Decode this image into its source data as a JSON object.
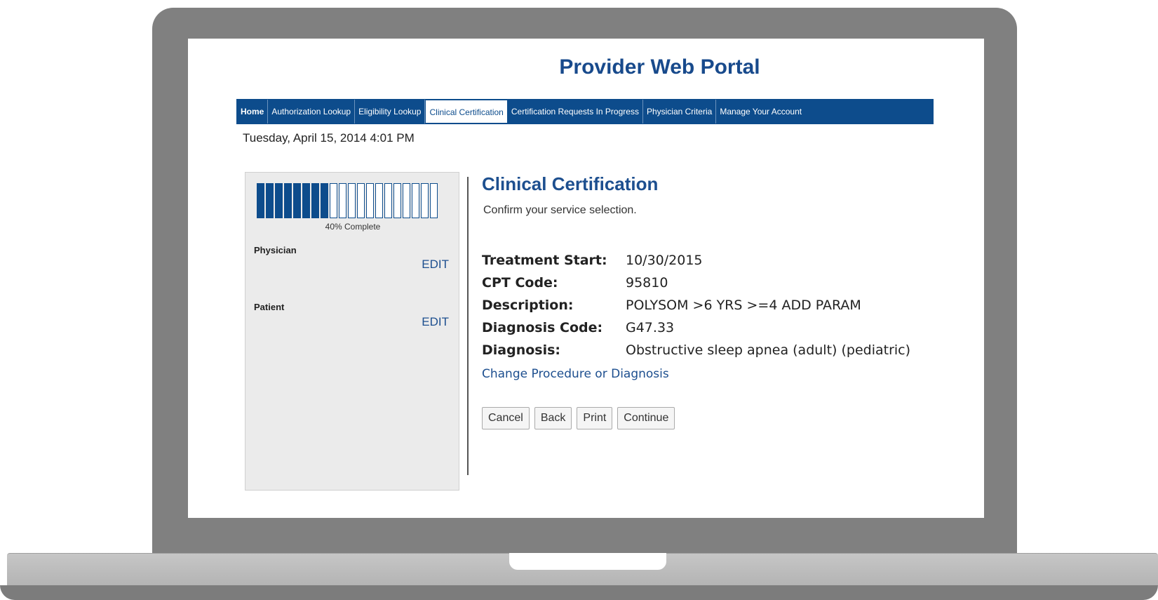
{
  "portal": {
    "title": "Provider Web Portal",
    "date": "Tuesday, April 15, 2014 4:01 PM"
  },
  "nav": {
    "tabs": [
      {
        "label": "Home"
      },
      {
        "label": "Authorization Lookup"
      },
      {
        "label": "Eligibility Lookup"
      },
      {
        "label": "Clinical Certification"
      },
      {
        "label": "Certification Requests In Progress"
      },
      {
        "label": "Physician Criteria"
      },
      {
        "label": "Manage Your Account"
      }
    ],
    "active_tab": "Clinical Certification"
  },
  "progress": {
    "fraction": 0.4,
    "segments_total": 20,
    "segments_filled": 8,
    "label": "40% Complete"
  },
  "panel": {
    "physician_label": "Physician",
    "patient_label": "Patient",
    "edit_label": "EDIT"
  },
  "content": {
    "title": "Clinical Certification",
    "subtitle": "Confirm your service selection.",
    "details": [
      {
        "label": "Treatment Start:",
        "value": "10/30/2015"
      },
      {
        "label": "CPT Code:",
        "value": "95810"
      },
      {
        "label": "Description:",
        "value": "POLYSOM >6 YRS >=4 ADD PARAM"
      },
      {
        "label": "Diagnosis Code:",
        "value": "G47.33"
      },
      {
        "label": "Diagnosis:",
        "value": "Obstructive sleep apnea (adult) (pediatric)"
      }
    ],
    "change_link": "Change Procedure or Diagnosis",
    "buttons": {
      "cancel": "Cancel",
      "back": "Back",
      "print": "Print",
      "continue": "Continue"
    }
  },
  "colors": {
    "brand_blue": "#0d4c8c",
    "link_blue": "#1d4f8f",
    "frame_gray": "#808080"
  }
}
